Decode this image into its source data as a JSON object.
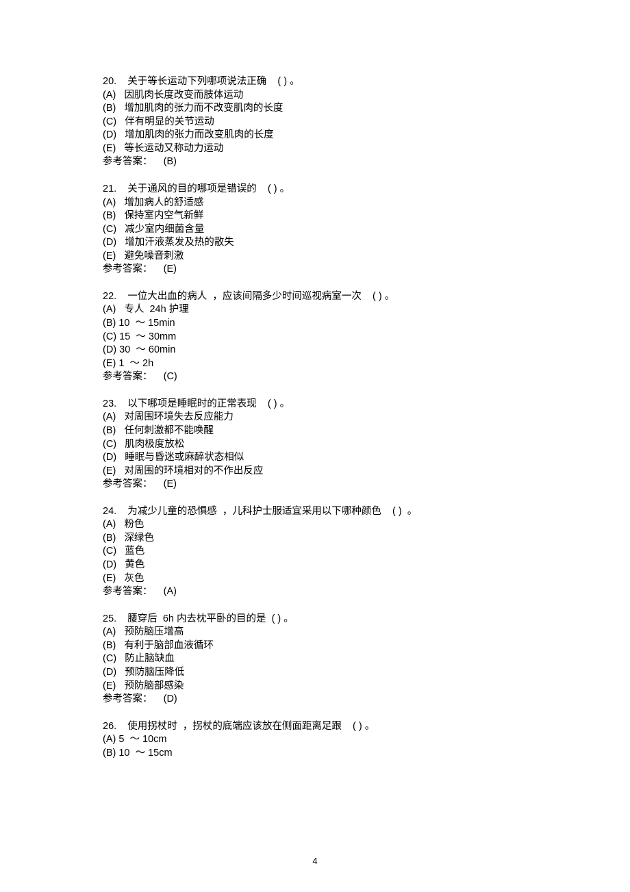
{
  "page_number": "4",
  "questions": [
    {
      "num": "20.",
      "stem_parts": [
        "关于等长运动下列哪项说法正确",
        "( )",
        "。"
      ],
      "options": [
        {
          "label": "(A)",
          "text": "因肌肉长度改变而肢体运动"
        },
        {
          "label": "(B)",
          "text": "增加肌肉的张力而不改变肌肉的长度"
        },
        {
          "label": "(C)",
          "text": "伴有明显的关节运动"
        },
        {
          "label": "(D)",
          "text": "增加肌肉的张力而改变肌肉的长度"
        },
        {
          "label": "(E)",
          "text": "等长运动又称动力运动"
        }
      ],
      "answer_label": "参考答案：",
      "answer": "(B)"
    },
    {
      "num": "21.",
      "stem_parts": [
        "关于通风的目的哪项是错误的",
        "( )",
        "。"
      ],
      "options": [
        {
          "label": "(A)",
          "text": "增加病人的舒适感"
        },
        {
          "label": "(B)",
          "text": "保持室内空气新鲜"
        },
        {
          "label": "(C)",
          "text": "减少室内细菌含量"
        },
        {
          "label": "(D)",
          "text": "增加汗液蒸发及热的散失"
        },
        {
          "label": "(E)",
          "text": "避免噪音刺激"
        }
      ],
      "answer_label": "参考答案：",
      "answer": "(E)"
    },
    {
      "num": "22.",
      "stem_parts": [
        "一位大出血的病人",
        "，应该间隔多少时间巡视病室一次",
        "( )",
        "。"
      ],
      "options": [
        {
          "label": "(A)",
          "text": "专人  24h 护理"
        },
        {
          "label": "(B) 10",
          "text": "～ 15min"
        },
        {
          "label": "(C) 15",
          "text": "～ 30mm"
        },
        {
          "label": "(D) 30",
          "text": "～ 60min"
        },
        {
          "label": "(E) 1",
          "text": "～ 2h"
        }
      ],
      "answer_label": "参考答案：",
      "answer": "(C)"
    },
    {
      "num": "23.",
      "stem_parts": [
        "以下哪项是睡眠时的正常表现",
        "( )",
        "。"
      ],
      "options": [
        {
          "label": "(A)",
          "text": "对周围环境失去反应能力"
        },
        {
          "label": "(B)",
          "text": "任何刺激都不能唤醒"
        },
        {
          "label": "(C)",
          "text": "肌肉极度放松"
        },
        {
          "label": "(D)",
          "text": "睡眠与昏迷或麻醉状态相似"
        },
        {
          "label": "(E)",
          "text": "对周围的环境相对的不作出反应"
        }
      ],
      "answer_label": "参考答案：",
      "answer": "(E)"
    },
    {
      "num": "24.",
      "stem_parts": [
        "为减少儿童的恐惧感",
        "，儿科护士服适宜采用以下哪种颜色",
        "( )",
        "。"
      ],
      "options": [
        {
          "label": "(A)",
          "text": "粉色"
        },
        {
          "label": "(B)",
          "text": "深绿色"
        },
        {
          "label": "(C)",
          "text": "蓝色"
        },
        {
          "label": "(D)",
          "text": "黄色"
        },
        {
          "label": "(E)",
          "text": "灰色"
        }
      ],
      "answer_label": "参考答案：",
      "answer": "(A)"
    },
    {
      "num": "25.",
      "stem_parts": [
        "腰穿后  6h 内去枕平卧的目的是",
        "( )",
        "。"
      ],
      "options": [
        {
          "label": "(A)",
          "text": "预防脑压增高"
        },
        {
          "label": "(B)",
          "text": "有利于脑部血液循环"
        },
        {
          "label": "(C)",
          "text": "防止脑缺血"
        },
        {
          "label": "(D)",
          "text": "预防脑压降低"
        },
        {
          "label": "(E)",
          "text": "预防脑部感染"
        }
      ],
      "answer_label": "参考答案：",
      "answer": "(D)"
    },
    {
      "num": "26.",
      "stem_parts": [
        "使用拐杖时",
        "，拐杖的底端应该放在侧面距离足跟",
        "( )",
        "。"
      ],
      "options": [
        {
          "label": "(A) 5",
          "text": "～ 10cm"
        },
        {
          "label": "(B) 10",
          "text": "～ 15cm"
        }
      ],
      "answer_label": "",
      "answer": ""
    }
  ]
}
